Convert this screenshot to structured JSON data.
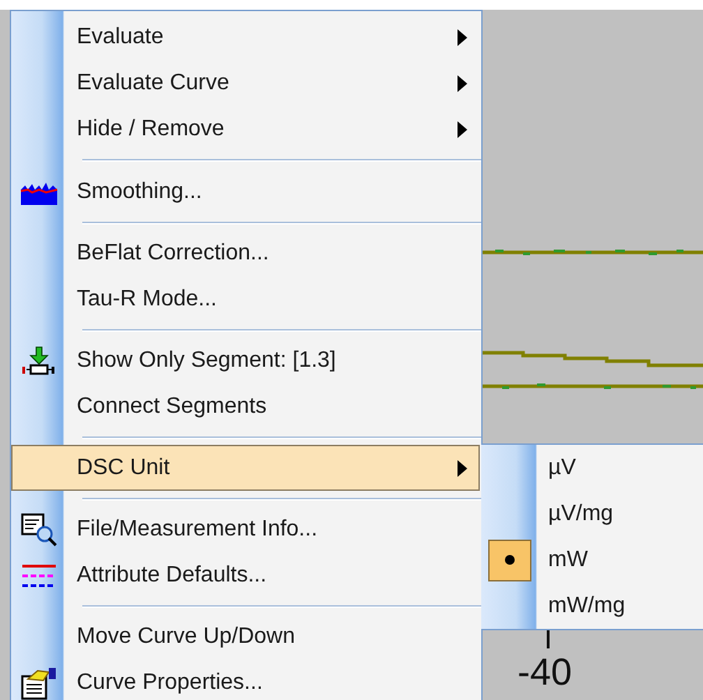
{
  "plot": {
    "tick_label": "-40"
  },
  "menu": {
    "items": [
      {
        "kind": "item",
        "label": "Evaluate",
        "has_submenu": true,
        "selected": false
      },
      {
        "kind": "item",
        "label": "Evaluate Curve",
        "has_submenu": true,
        "selected": false
      },
      {
        "kind": "item",
        "label": "Hide / Remove",
        "has_submenu": true,
        "selected": false
      },
      {
        "kind": "separator"
      },
      {
        "kind": "item",
        "label": "Smoothing...",
        "has_submenu": false,
        "selected": false
      },
      {
        "kind": "separator"
      },
      {
        "kind": "item",
        "label": "BeFlat Correction...",
        "has_submenu": false,
        "selected": false
      },
      {
        "kind": "item",
        "label": "Tau-R Mode...",
        "has_submenu": false,
        "selected": false
      },
      {
        "kind": "separator"
      },
      {
        "kind": "item",
        "label": "Show Only Segment: [1.3]",
        "has_submenu": false,
        "selected": false
      },
      {
        "kind": "item",
        "label": "Connect Segments",
        "has_submenu": false,
        "selected": false
      },
      {
        "kind": "separator"
      },
      {
        "kind": "item",
        "label": "DSC Unit",
        "has_submenu": true,
        "selected": true
      },
      {
        "kind": "separator"
      },
      {
        "kind": "item",
        "label": "File/Measurement Info...",
        "has_submenu": false,
        "selected": false
      },
      {
        "kind": "item",
        "label": "Attribute Defaults...",
        "has_submenu": false,
        "selected": false
      },
      {
        "kind": "separator"
      },
      {
        "kind": "item",
        "label": "Move Curve Up/Down",
        "has_submenu": false,
        "selected": false
      },
      {
        "kind": "item",
        "label": "Curve Properties...",
        "has_submenu": false,
        "selected": false
      }
    ]
  },
  "submenu": {
    "items": [
      {
        "label": "µV",
        "selected": false
      },
      {
        "label": "µV/mg",
        "selected": false
      },
      {
        "label": "mW",
        "selected": true
      },
      {
        "label": "mW/mg",
        "selected": false
      }
    ]
  }
}
